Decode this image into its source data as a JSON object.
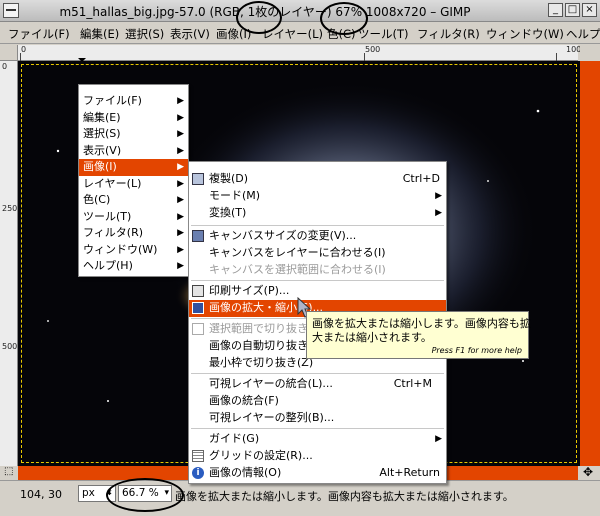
{
  "window": {
    "title": "m51_hallas_big.jpg-57.0 (RGB, 1枚のレイヤー) 67% 1008x720 – GIMP",
    "buttons": [
      "_",
      "□",
      "×"
    ]
  },
  "menubar": {
    "items": [
      "ファイル(F)",
      "編集(E)",
      "選択(S)",
      "表示(V)",
      "画像(I)",
      "レイヤー(L)",
      "色(C)",
      "ツール(T)",
      "フィルタ(R)",
      "ウィンドウ(W)",
      "ヘルプ"
    ]
  },
  "rulers": {
    "h_labels": [
      "0",
      "500",
      "1000"
    ],
    "v_labels": [
      "0",
      "250",
      "500"
    ]
  },
  "context_menu": {
    "items": [
      {
        "label": "ファイル(F)",
        "has_submenu": true
      },
      {
        "label": "編集(E)",
        "has_submenu": true
      },
      {
        "label": "選択(S)",
        "has_submenu": true
      },
      {
        "label": "表示(V)",
        "has_submenu": true
      },
      {
        "label": "画像(I)",
        "has_submenu": true,
        "selected": true
      },
      {
        "label": "レイヤー(L)",
        "has_submenu": true
      },
      {
        "label": "色(C)",
        "has_submenu": true
      },
      {
        "label": "ツール(T)",
        "has_submenu": true
      },
      {
        "label": "フィルタ(R)",
        "has_submenu": true
      },
      {
        "label": "ウィンドウ(W)",
        "has_submenu": true
      },
      {
        "label": "ヘルプ(H)",
        "has_submenu": true
      }
    ]
  },
  "image_menu": {
    "items": [
      {
        "label": "複製(D)",
        "accel": "Ctrl+D",
        "icon": "duplicate-icon"
      },
      {
        "label": "モード(M)",
        "has_submenu": true
      },
      {
        "label": "変換(T)",
        "has_submenu": true
      },
      {
        "label": "キャンバスサイズの変更(V)...",
        "icon": "canvas-size-icon"
      },
      {
        "label": "キャンバスをレイヤーに合わせる(I)"
      },
      {
        "label": "キャンバスを選択範囲に合わせる(I)",
        "disabled": true
      },
      {
        "label": "印刷サイズ(P)...",
        "icon": "print-size-icon"
      },
      {
        "label": "画像の拡大・縮小(S)...",
        "icon": "scale-image-icon",
        "selected": true
      },
      {
        "label": "選択範囲で切り抜き(C)",
        "disabled": true,
        "icon": "crop-icon"
      },
      {
        "label": "画像の自動切り抜き(F)"
      },
      {
        "label": "最小枠で切り抜き(Z)"
      },
      {
        "label": "可視レイヤーの統合(L)...",
        "accel": "Ctrl+M"
      },
      {
        "label": "画像の統合(F)"
      },
      {
        "label": "可視レイヤーの整列(B)..."
      },
      {
        "label": "ガイド(G)",
        "has_submenu": true
      },
      {
        "label": "グリッドの設定(R)...",
        "icon": "grid-icon"
      },
      {
        "label": "画像の情報(O)",
        "accel": "Alt+Return",
        "icon": "info-icon"
      }
    ]
  },
  "tooltip": {
    "text_line1": "画像を拡大または縮小します。画像内容も拡",
    "text_line2": "大または縮小されます。",
    "help_hint": "Press F1 for more help"
  },
  "statusbar": {
    "coords": "104, 30",
    "unit": "px",
    "zoom": "66.7 %",
    "message": "画像を拡大または縮小します。画像内容も拡大または縮小されます。"
  },
  "colors": {
    "accent": "#e34500",
    "tooltip_bg": "#ffffd2",
    "canvas_bg": "#050509"
  }
}
